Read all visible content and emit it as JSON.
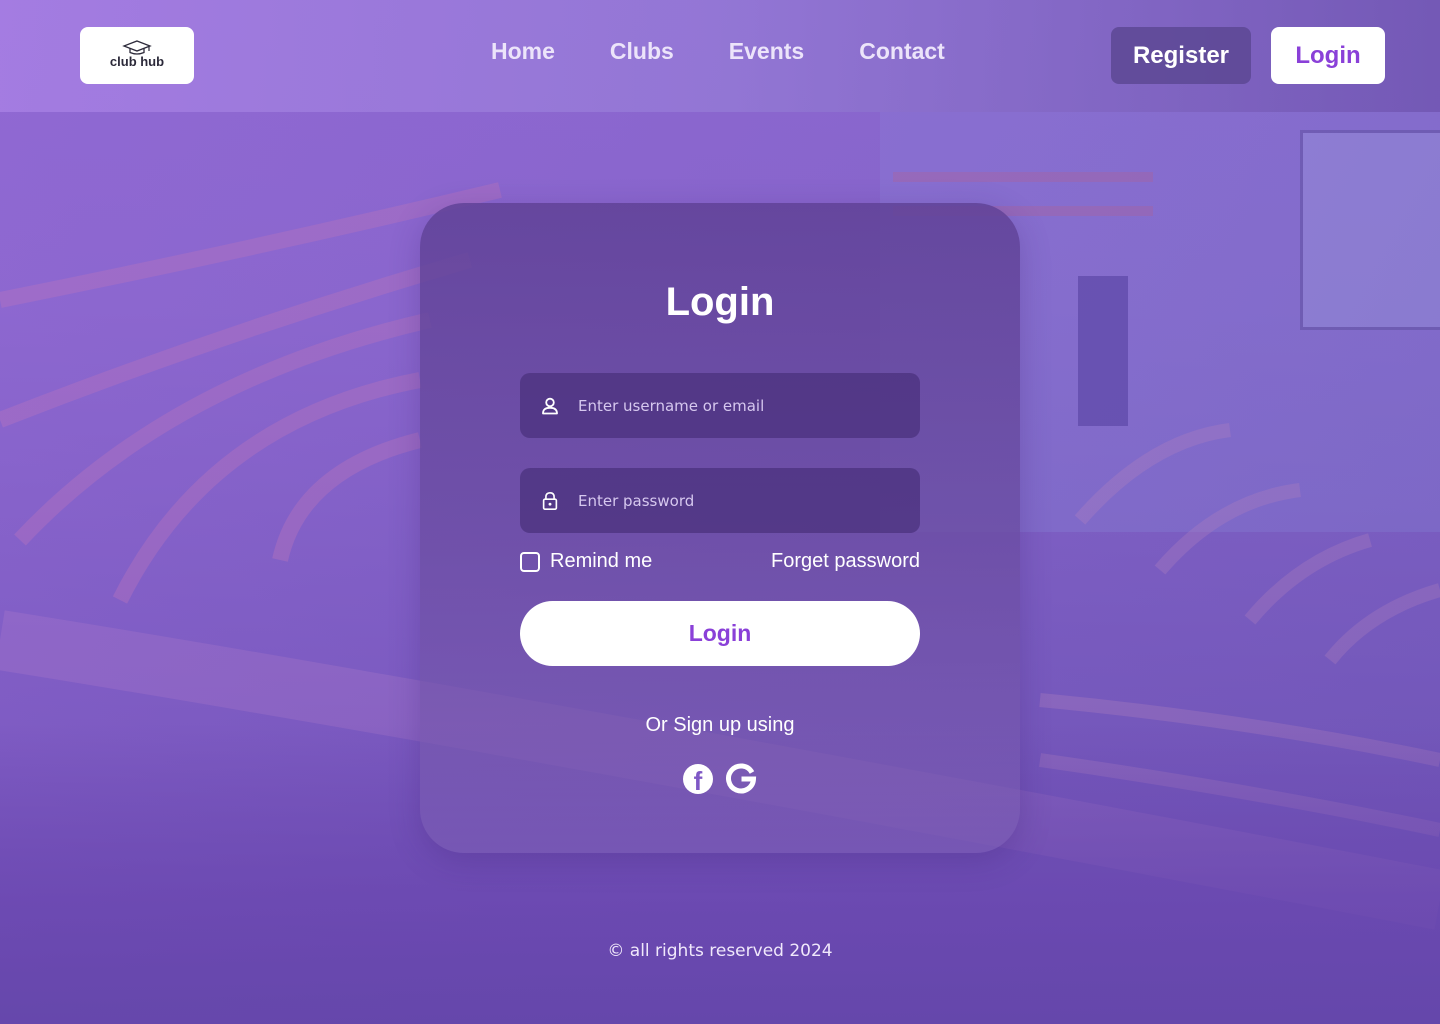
{
  "brand": {
    "logo_text": "club hub"
  },
  "nav": {
    "items": [
      {
        "label": "Home"
      },
      {
        "label": "Clubs"
      },
      {
        "label": "Events"
      },
      {
        "label": "Contact"
      }
    ]
  },
  "header": {
    "register_label": "Register",
    "login_label": "Login"
  },
  "login_card": {
    "title": "Login",
    "username_placeholder": "Enter username or email",
    "password_placeholder": "Enter password",
    "remind_label": "Remind me",
    "forget_label": "Forget password",
    "submit_label": "Login",
    "signup_text": "Or Sign up using",
    "social": [
      {
        "icon": "facebook-icon"
      },
      {
        "icon": "google-icon"
      }
    ]
  },
  "footer": {
    "text": "© all rights reserved 2024"
  },
  "colors": {
    "accent": "#8a40d8",
    "card_bg": "#5f4196",
    "header_btn": "#5a4691"
  }
}
